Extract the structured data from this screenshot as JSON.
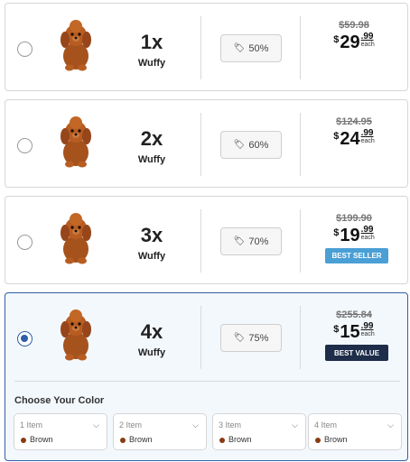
{
  "colors": {
    "selected_border": "#2f5fa7",
    "best_seller_badge": "#4a9fd5",
    "best_value_badge": "#1e2d4a",
    "swatch_brown": "#8a3b12"
  },
  "options": [
    {
      "qty": "1x",
      "name": "Wuffy",
      "discount": "50%",
      "old_price": "$59.98",
      "currency": "$",
      "dollars": "29",
      "cents": ".99",
      "each": "each",
      "badge": "",
      "selected": false
    },
    {
      "qty": "2x",
      "name": "Wuffy",
      "discount": "60%",
      "old_price": "$124.95",
      "currency": "$",
      "dollars": "24",
      "cents": ".99",
      "each": "each",
      "badge": "",
      "selected": false
    },
    {
      "qty": "3x",
      "name": "Wuffy",
      "discount": "70%",
      "old_price": "$199.90",
      "currency": "$",
      "dollars": "19",
      "cents": ".99",
      "each": "each",
      "badge": "BEST SELLER",
      "selected": false
    },
    {
      "qty": "4x",
      "name": "Wuffy",
      "discount": "75%",
      "old_price": "$255.84",
      "currency": "$",
      "dollars": "15",
      "cents": ".99",
      "each": "each",
      "badge": "BEST VALUE",
      "selected": true
    }
  ],
  "color_picker": {
    "title": "Choose Your Color",
    "selects": [
      {
        "label": "1 Item",
        "value": "Brown"
      },
      {
        "label": "2 Item",
        "value": "Brown"
      },
      {
        "label": "3 Item",
        "value": "Brown"
      },
      {
        "label": "4 Item",
        "value": "Brown"
      }
    ]
  },
  "icons": {
    "radio": "radio-button-icon",
    "discount": "tag-icon",
    "product": "puppy-image",
    "dropdown": "chevron-down-icon"
  }
}
